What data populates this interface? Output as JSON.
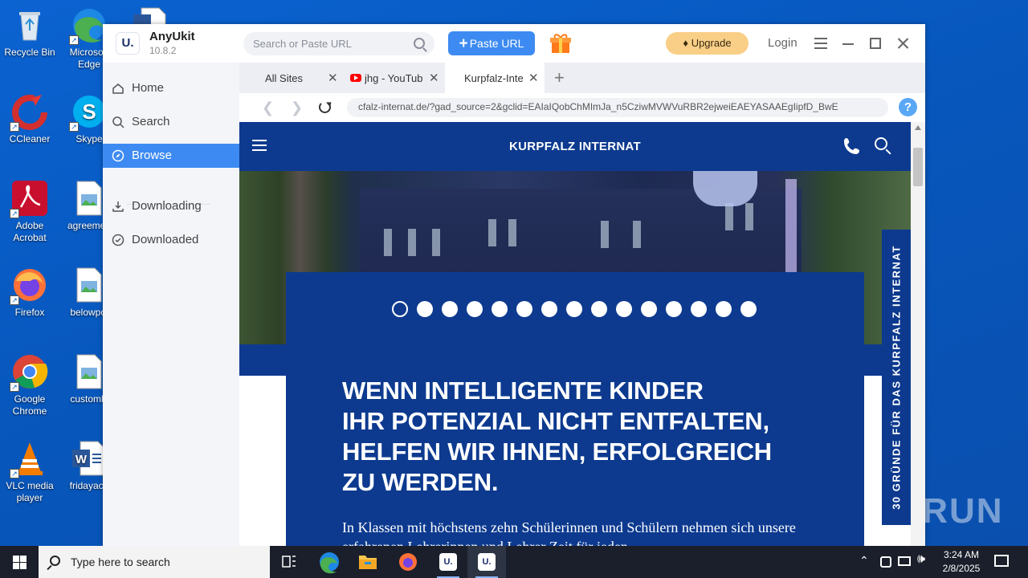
{
  "desktop": {
    "icons": [
      {
        "label": "Recycle Bin"
      },
      {
        "label": "Microsoft Edge"
      },
      {
        "label": "CCleaner"
      },
      {
        "label": "Skype"
      },
      {
        "label": "Adobe Acrobat"
      },
      {
        "label": "agreemen"
      },
      {
        "label": "Firefox"
      },
      {
        "label": "belowpol"
      },
      {
        "label": "Google Chrome"
      },
      {
        "label": "customlif"
      },
      {
        "label": "VLC media player"
      },
      {
        "label": "fridayaca"
      }
    ]
  },
  "app": {
    "logo": "U.",
    "name": "AnyUkit",
    "version": "10.8.2",
    "search_placeholder": "Search or Paste URL",
    "paste_url_label": "Paste URL",
    "upgrade_label": "Upgrade",
    "login_label": "Login",
    "sidebar": [
      {
        "label": "Home",
        "icon": "home-icon"
      },
      {
        "label": "Search",
        "icon": "search-icon"
      },
      {
        "label": "Browse",
        "icon": "compass-icon",
        "active": true
      },
      {
        "label": "Downloading",
        "icon": "download-icon"
      },
      {
        "label": "Downloaded",
        "icon": "check-circle-icon"
      }
    ],
    "tabs": [
      {
        "label": "All Sites"
      },
      {
        "label": "jhg - YouTub"
      },
      {
        "label": "Kurpfalz-Inte",
        "active": true
      }
    ],
    "url": "cfalz-internat.de/?gad_source=2&gclid=EAIaIQobChMImJa_n5CziwMVWVuRBR2ejweiEAEYASAAEgIipfD_BwE",
    "accent_color": "#3d8bf2"
  },
  "website": {
    "title": "KURPFALZ INTERNAT",
    "brand_color": "#0d3a8f",
    "slider_dot_count": 15,
    "slider_current_index": 0,
    "headline_lines": [
      "WENN INTELLIGENTE KINDER",
      "IHR POTENZIAL NICHT ENTFALTEN,",
      "HELFEN WIR IHNEN, ERFOLGREICH",
      "ZU WERDEN."
    ],
    "intro": "In Klassen mit höchstens zehn Schülerinnen und Schülern nehmen sich unsere erfahrenen Lehrerinnen und Lehrer Zeit für jeden",
    "side_badge": "30 GRÜNDE FÜR DAS KURPFALZ INTERNAT"
  },
  "watermark": "ANY.RUN",
  "taskbar": {
    "search_placeholder": "Type here to search",
    "time": "3:24 AM",
    "date": "2/8/2025"
  }
}
